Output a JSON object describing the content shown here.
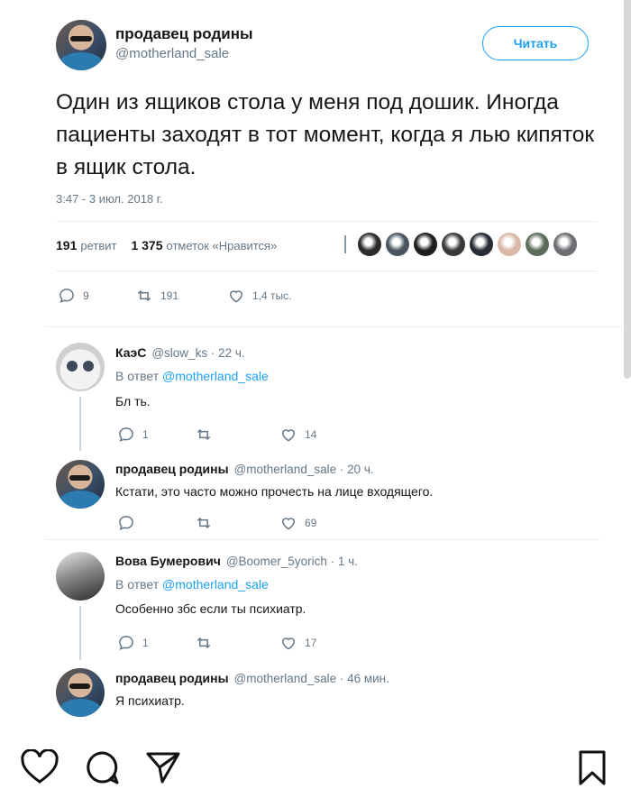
{
  "tweet": {
    "author_name": "продавец родины",
    "author_handle": "@motherland_sale",
    "follow_label": "Читать",
    "text": "Один из ящиков стола у меня под дошик. Иногда пациенты заходят в тот момент, когда я лью кипяток в ящик стола.",
    "timestamp": "3:47 - 3 июл. 2018 г.",
    "retweets_count": "191",
    "retweets_label": "ретвит",
    "likes_count": "1 375",
    "likes_label": "отметок «Нравится»",
    "actions": {
      "replies": "9",
      "retweets": "191",
      "likes": "1,4 тыс."
    }
  },
  "replies": [
    {
      "name": "КаэС",
      "meta": "@slow_ks · 22 ч.",
      "in_reply_prefix": "В ответ",
      "in_reply_handle": "@motherland_sale",
      "text": "Бл  ть.",
      "replies": "1",
      "retweets": "",
      "likes": "14"
    },
    {
      "name": "продавец родины",
      "meta": "@motherland_sale · 20 ч.",
      "text": "Кстати, это часто можно прочесть на лице входящего.",
      "replies": "",
      "retweets": "",
      "likes": "69"
    },
    {
      "name": "Вова Бумерович",
      "meta": "@Boomer_5yorich · 1 ч.",
      "in_reply_prefix": "В ответ",
      "in_reply_handle": "@motherland_sale",
      "text": "Особенно збс если ты психиатр.",
      "replies": "1",
      "retweets": "",
      "likes": "17"
    },
    {
      "name": "продавец родины",
      "meta": "@motherland_sale · 46 мин.",
      "text": "Я психиатр."
    }
  ],
  "likers": [
    "#2b2b2b",
    "#4a5560",
    "#1e1e1e",
    "#3a3a3a",
    "#262c33",
    "#d9b8a8",
    "#5b6b5a",
    "#6d6d72"
  ],
  "colors": {
    "accent": "#1da1f2",
    "muted": "#657786",
    "text": "#14171a"
  },
  "ig_icons": [
    "heart-icon",
    "comment-icon",
    "share-icon",
    "bookmark-icon"
  ]
}
